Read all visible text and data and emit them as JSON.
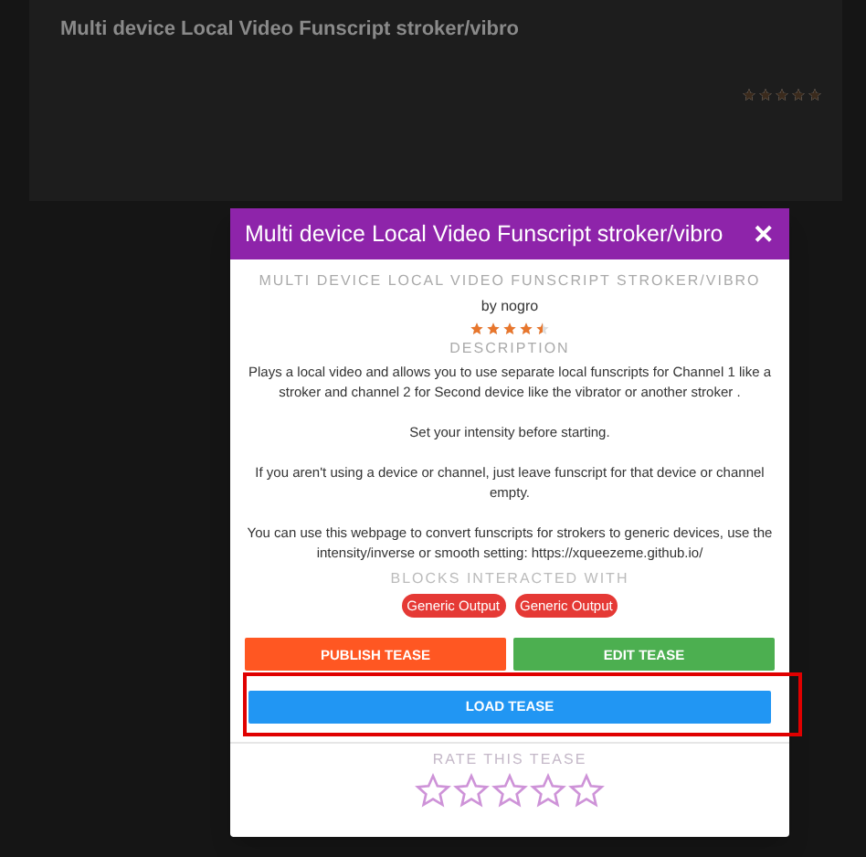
{
  "background_card": {
    "title": "Multi device Local Video Funscript stroker/vibro",
    "stars": 5
  },
  "modal": {
    "title": "Multi device Local Video Funscript stroker/vibro",
    "close": "✕",
    "heading": "MULTI DEVICE LOCAL VIDEO FUNSCRIPT STROKER/VIBRO",
    "author": "by nogro",
    "stars": 4.5,
    "description_label": "DESCRIPTION",
    "paragraphs": [
      "Plays a local video and allows you to use separate local funscripts for Channel 1 like a stroker and  channel 2 for Second device like the vibrator or another stroker .",
      "Set your intensity before starting.",
      "If you aren't using a device or channel, just leave funscript for that device or channel empty.",
      "You can use this webpage to convert funscripts for strokers to generic devices, use the intensity/inverse or smooth setting: https://xqueezeme.github.io/"
    ],
    "blocks_label": "BLOCKS INTERACTED WITH",
    "blocks": [
      "Generic Output",
      "Generic Output"
    ],
    "buttons": [
      {
        "label": "PUBLISH TEASE",
        "color": "#ff5722"
      },
      {
        "label": "EDIT TEASE",
        "color": "#4caf50"
      }
    ],
    "load_button": {
      "label": "LOAD TEASE",
      "highlighted": true
    },
    "rate_label": "RATE THIS TEASE",
    "rating": {
      "stars": 0
    }
  }
}
